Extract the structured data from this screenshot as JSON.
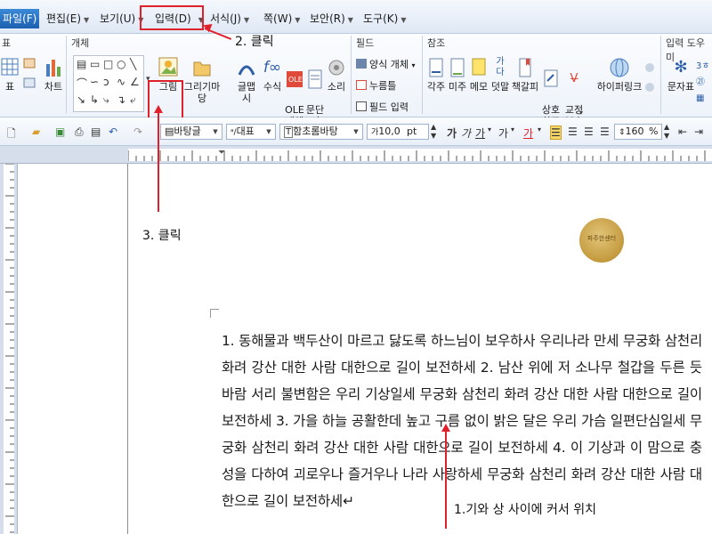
{
  "menu": {
    "file": "파일(F)",
    "items": [
      "편집(E)",
      "보기(U)",
      "입력(D)",
      "서식(J)",
      "쪽(W)",
      "보안(R)",
      "도구(K)"
    ]
  },
  "ribbon": {
    "left_group_title": "표",
    "object_group_title": "개체",
    "field_group_title": "필드",
    "ref_group_title": "참조",
    "input_help_title": "입력 도우미",
    "table_label": "표",
    "chart_label": "차트",
    "picture_label": "그림",
    "drawing_label": "그리기마당",
    "clipart_label": "글맵시",
    "formula_label": "수식",
    "ole_label": "OLE\n개체",
    "docs_label": "문단\n띠",
    "sound_label": "소리",
    "field_form_obj": "양식 개체",
    "field_press": "누름틀",
    "field_input": "필드 입력",
    "ref_buttons": [
      "각주",
      "미주",
      "메모",
      "덧말",
      "책갈피",
      "상호\n참조",
      "교정\n부호"
    ],
    "hyperlink_label": "하이퍼링크",
    "chartable_label": "문자표"
  },
  "toolbar": {
    "style_value": "바탕글",
    "lang_value": "대표",
    "font_value": "함초롬바탕",
    "size_value": "10,0",
    "size_unit": "pt",
    "zoom_value": "160",
    "zoom_unit": "%"
  },
  "document": {
    "seal_text": "파주한센터",
    "body": "1. 동해물과 백두산이 마르고 닳도록 하느님이 보우하사 우리나라 만세 무궁화 삼천리 화려 강산 대한 사람 대한으로 길이 보전하세 2. 남산 위에 저 소나무 철갑을 두른 듯 바람 서리 불변함은 우리 기상일세 무궁화 삼천리 화려 강산 대한 사람 대한으로 길이 보전하세 3. 가을 하늘 공활한데 높고 구름 없이 밝은 달은 우리 가슴 일편단심일세 무궁화 삼천리 화려 강산 대한 사람 대한으로 길이 보전하세 4. 이 기상과 이 맘으로 충성을 다하여 괴로우나 즐거우나 나라 사랑하세 무궁화 삼천리 화려 강산 대한 사람 대한으로 길이 보전하세↵"
  },
  "annotations": {
    "step1": "1.기와 상 사이에 커서 위치",
    "step2": "2. 클릭",
    "step3": "3. 클릭"
  },
  "colors": {
    "accent_red": "#e0202a",
    "file_blue": "#1d5fb0"
  }
}
